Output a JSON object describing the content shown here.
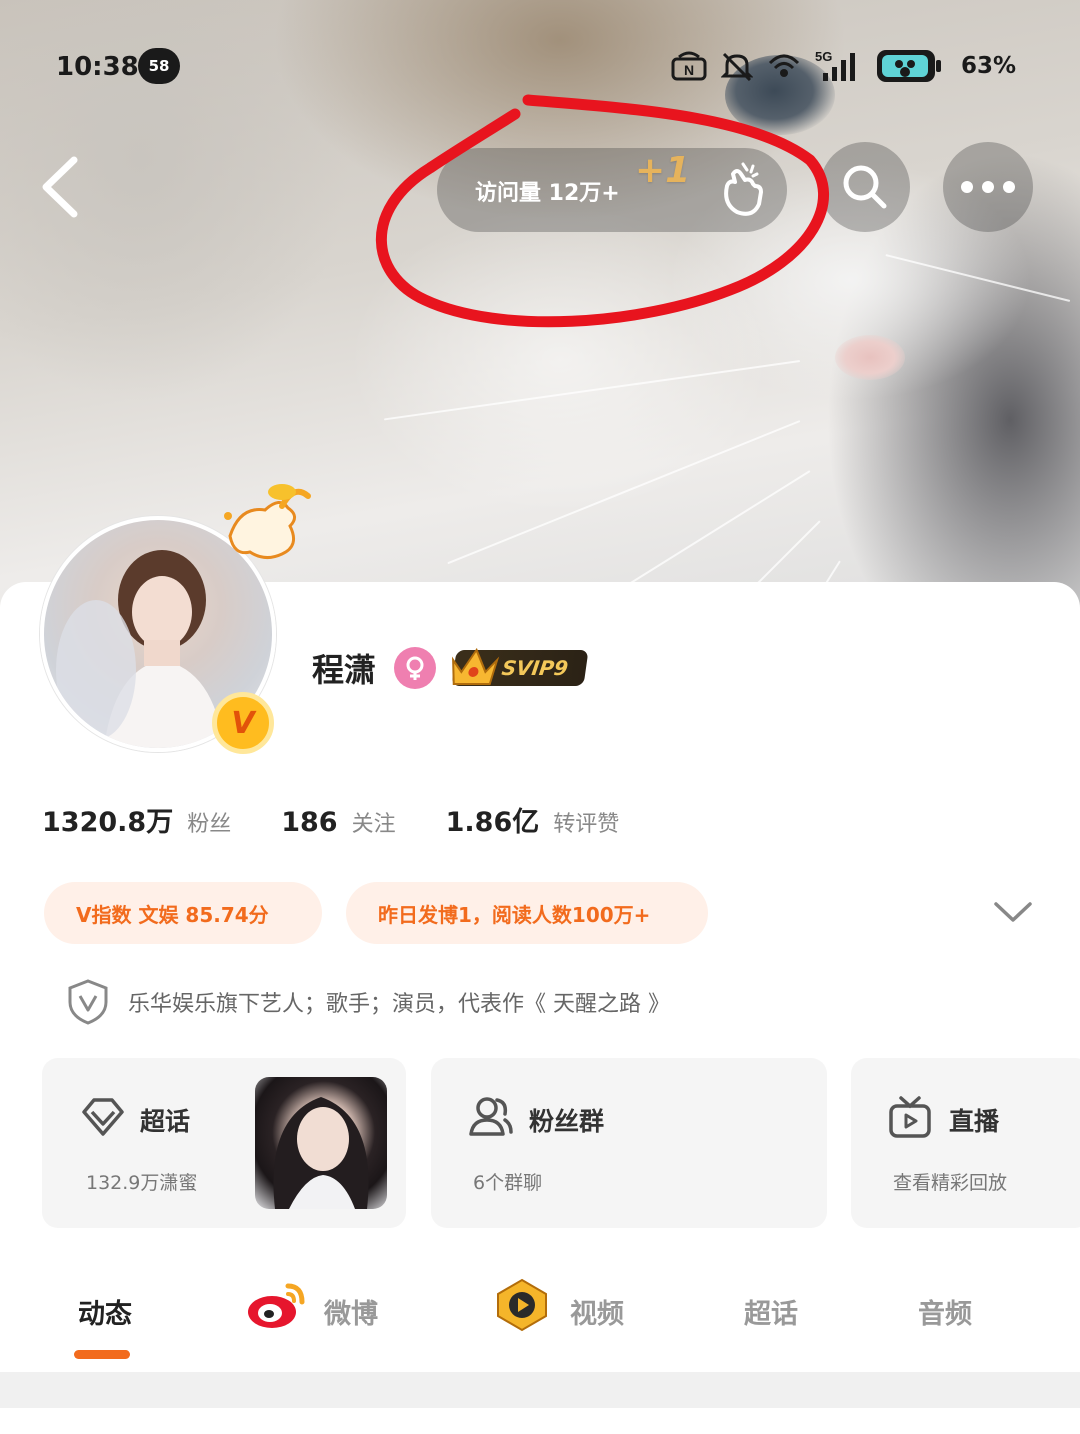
{
  "status_bar": {
    "time": "10:38",
    "notification_count": "58",
    "network": "5G",
    "battery": "63%"
  },
  "top_nav": {
    "visit_label": "访问量  12万+",
    "visit_increment": "+1",
    "icons": [
      "back-icon",
      "finger-heart-icon",
      "search-icon",
      "more-icon"
    ]
  },
  "profile": {
    "name": "程潇",
    "gender_icon": "female-icon",
    "vip_badge": "SVIP9",
    "stats": [
      {
        "value": "1320.8万",
        "label": "粉丝"
      },
      {
        "value": "186",
        "label": "关注"
      },
      {
        "value": "1.86亿",
        "label": "转评赞"
      }
    ],
    "chips": [
      "V指数  文娱  85.74分",
      "昨日发博1，阅读人数100万+"
    ],
    "bio": "乐华娱乐旗下艺人；歌手；演员，代表作《 天醒之路 》"
  },
  "feature_cards": [
    {
      "title": "超话",
      "subtitle": "132.9万潇蜜",
      "icon": "diamond-icon"
    },
    {
      "title": "粉丝群",
      "subtitle": "6个群聊",
      "icon": "group-icon"
    },
    {
      "title": "直播",
      "subtitle": "查看精彩回放",
      "icon": "tv-icon"
    }
  ],
  "tabs": [
    {
      "label": "动态",
      "active": true
    },
    {
      "label": "微博",
      "icon": "weibo-icon"
    },
    {
      "label": "视频",
      "icon": "video-icon"
    },
    {
      "label": "超话"
    },
    {
      "label": "音频"
    }
  ],
  "colors": {
    "accent": "#f26b1d",
    "chip_bg": "#fff0e8",
    "annotation_red": "#e8141e"
  }
}
